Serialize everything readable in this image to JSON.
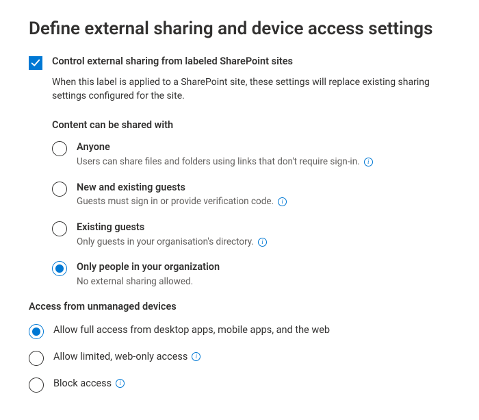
{
  "title": "Define external sharing and device access settings",
  "control_checkbox": {
    "label": "Control external sharing from labeled SharePoint sites",
    "description": "When this label is applied to a SharePoint site, these settings will replace existing sharing settings configured for the site.",
    "checked": true
  },
  "share_section": {
    "heading": "Content can be shared with",
    "options": [
      {
        "label": "Anyone",
        "desc": "Users can share files and folders using links that don't require sign-in.",
        "info": true,
        "selected": false
      },
      {
        "label": "New and existing guests",
        "desc": "Guests must sign in or provide verification code.",
        "info": true,
        "selected": false
      },
      {
        "label": "Existing guests",
        "desc": "Only guests in your organisation's directory.",
        "info": true,
        "selected": false
      },
      {
        "label": "Only people in your organization",
        "desc": "No external sharing allowed.",
        "info": false,
        "selected": true
      }
    ]
  },
  "device_section": {
    "heading": "Access from unmanaged devices",
    "options": [
      {
        "label": "Allow full access from desktop apps, mobile apps, and the web",
        "info": false,
        "selected": true
      },
      {
        "label": "Allow limited, web-only access",
        "info": true,
        "selected": false
      },
      {
        "label": "Block access",
        "info": true,
        "selected": false
      }
    ]
  }
}
